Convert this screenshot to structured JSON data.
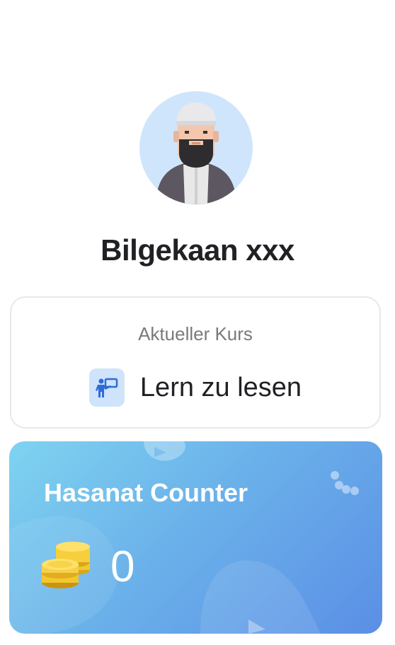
{
  "profile": {
    "avatar_icon": "user-avatar-icon",
    "name": "Bilgekaan xxx"
  },
  "course": {
    "label": "Aktueller Kurs",
    "name": "Lern zu lesen",
    "icon": "teacher-board-icon"
  },
  "hasanat": {
    "title": "Hasanat Counter",
    "count": "0",
    "icon": "coins-icon"
  },
  "colors": {
    "card_gradient_start": "#7fd3f0",
    "card_gradient_end": "#5b8fe6",
    "course_icon_bg": "#cfe3fb",
    "avatar_bg": "#cfe5fb"
  }
}
